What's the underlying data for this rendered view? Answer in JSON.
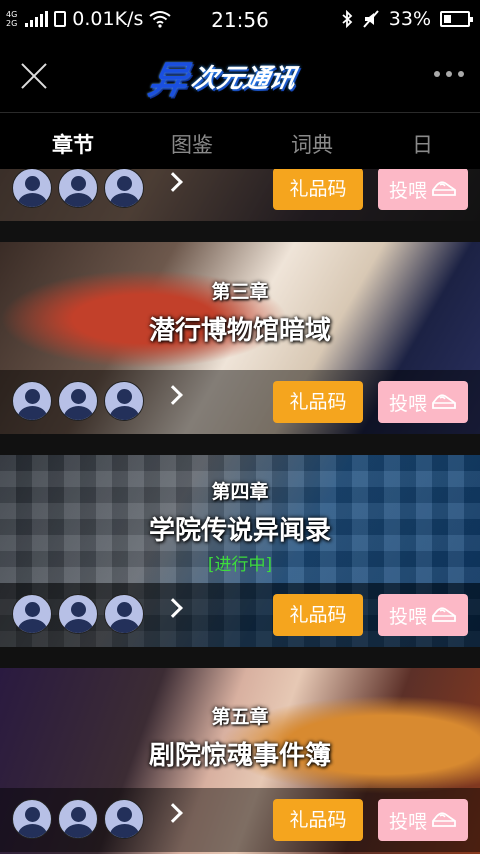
{
  "status_bar": {
    "net_top": "4G",
    "net_bottom": "2G",
    "speed": "0.01K/s",
    "time": "21:56",
    "battery": "33%",
    "battery_level": 0.33
  },
  "header": {
    "logo_glyph": "异",
    "logo_rest": "次元通讯"
  },
  "tabs": [
    {
      "label": "章节",
      "active": true
    },
    {
      "label": "图鉴",
      "active": false
    },
    {
      "label": "词典",
      "active": false
    },
    {
      "label": "日",
      "active": false
    }
  ],
  "actions": {
    "gift_label": "礼品码",
    "feed_label": "投喂"
  },
  "chapters": [
    {
      "number": "",
      "title": "",
      "status": ""
    },
    {
      "number": "第三章",
      "title": "潜行博物馆暗域",
      "status": ""
    },
    {
      "number": "第四章",
      "title": "学院传说异闻录",
      "status": "[进行中]"
    },
    {
      "number": "第五章",
      "title": "剧院惊魂事件簿",
      "status": ""
    }
  ]
}
